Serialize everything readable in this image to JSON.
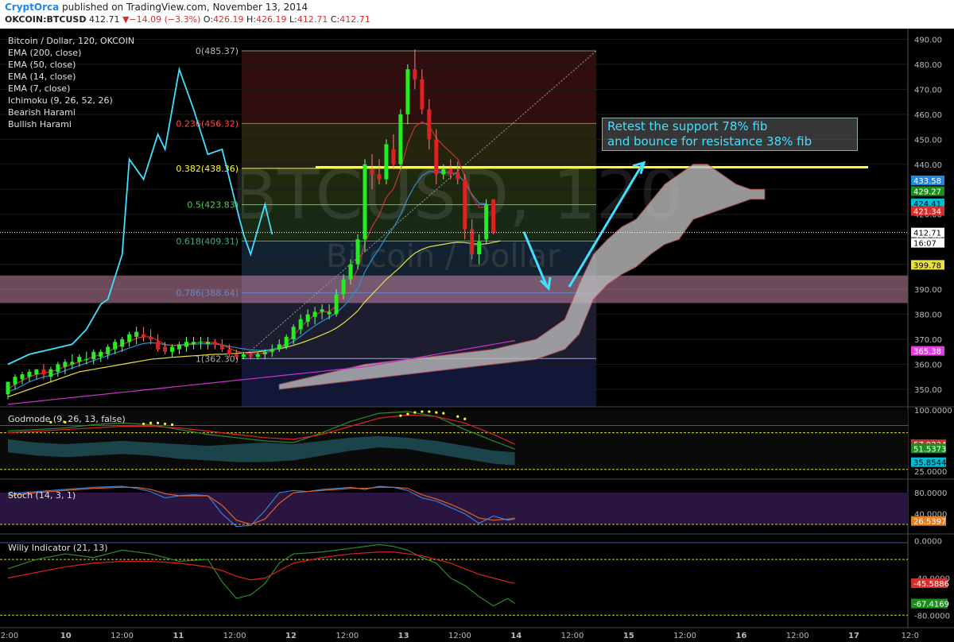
{
  "header": {
    "author": "CryptOrca",
    "published": "published on TradingView.com, November 13, 2014",
    "symbol": "OKCOIN:BTCUSD",
    "last": "412.71",
    "change_arrow": "▼",
    "change": "−14.09 (−3.3%)",
    "o_label": "O:",
    "o": "426.19",
    "h_label": "H:",
    "h": "426.19",
    "l_label": "L:",
    "l": "412.71",
    "c_label": "C:",
    "c": "412.71"
  },
  "colors": {
    "background": "#000000",
    "bull": "#22ee22",
    "bear": "#dd2222",
    "ema200": "#cc33cc",
    "ema50": "#e8e040",
    "ema14": "#2a8fd0",
    "ema7": "#cc3333",
    "cyan_trend": "#40e0ff",
    "cloud": "#bbbbbb",
    "fib_line": "#ffff33",
    "support_band": "#c586a8"
  },
  "main_panel": {
    "title": "Bitcoin / Dollar, 120, OKCOIN",
    "indicators": [
      "EMA (200, close)",
      "EMA (50, close)",
      "EMA (14, close)",
      "EMA (7, close)",
      "Ichimoku (9, 26, 52, 26)",
      "Bearish Harami",
      "Bullish Harami"
    ],
    "watermark_symbol": "BTCUSD, 120",
    "watermark_name": "Bitcoin / Dollar",
    "annotation": [
      "Retest the support 78% fib",
      "and bounce for resistance 38% fib"
    ],
    "fib_levels": [
      {
        "label": "0(485.37)",
        "price": 485.37
      },
      {
        "label": "0.236(456.32)",
        "price": 456.32
      },
      {
        "label": "0.382(438.36)",
        "price": 438.36
      },
      {
        "label": "0.5(423.83)",
        "price": 423.83
      },
      {
        "label": "0.618(409.31)",
        "price": 409.31
      },
      {
        "label": "0.786(388.64)",
        "price": 388.64
      },
      {
        "label": "1(362.30)",
        "price": 362.3
      }
    ],
    "y_ticks": [
      "490.00",
      "480.00",
      "470.00",
      "460.00",
      "450.00",
      "440.00",
      "430.00",
      "420.00",
      "410.00",
      "400.00",
      "390.00",
      "380.00",
      "370.00",
      "360.00",
      "350.00"
    ],
    "price_badges": [
      {
        "text": "433.58",
        "price": 433.58,
        "color": "#1e88e5"
      },
      {
        "text": "429.27",
        "price": 429.27,
        "color": "#1b8f1b"
      },
      {
        "text": "424.41",
        "price": 424.41,
        "color": "#00bcd4"
      },
      {
        "text": "421.34",
        "price": 421.34,
        "color": "#d32f2f"
      },
      {
        "text": "412.71",
        "price": 412.71,
        "color": "#ffffff"
      },
      {
        "text": "16:07",
        "price": 408.6,
        "color": "#ffffff"
      },
      {
        "text": "399.78",
        "price": 399.78,
        "color": "#e8e040"
      },
      {
        "text": "365.38",
        "price": 365.38,
        "color": "#e040e0"
      }
    ]
  },
  "godmode_panel": {
    "title": "Godmode (9, 26, 13, false)",
    "y_ticks": [
      {
        "text": "100.0000",
        "v": 100
      },
      {
        "text": "25.0000",
        "v": 25
      }
    ],
    "badges": [
      {
        "text": "57.9234",
        "v": 57.9,
        "color": "#d32f2f"
      },
      {
        "text": "51.5373",
        "v": 52.8,
        "color": "#1b8f1b"
      },
      {
        "text": "35.8544",
        "v": 35.9,
        "color": "#00bcd4"
      }
    ]
  },
  "stoch_panel": {
    "title": "Stoch (14, 3, 1)",
    "y_ticks": [
      {
        "text": "80.0000",
        "v": 80
      },
      {
        "text": "40.0000",
        "v": 40
      }
    ],
    "badges": [
      {
        "text": "26.5397",
        "v": 26.5,
        "color": "#e67e22"
      }
    ]
  },
  "willy_panel": {
    "title": "Willy Indicator (21, 13)",
    "y_ticks": [
      {
        "text": "0.0000",
        "v": 0
      },
      {
        "text": "-40.0000",
        "v": -40
      },
      {
        "text": "-80.0000",
        "v": -80
      }
    ],
    "badges": [
      {
        "text": "-45.5886",
        "v": -45.6,
        "color": "#d32f2f"
      },
      {
        "text": "-67.4169",
        "v": -67.4,
        "color": "#1b8f1b"
      }
    ]
  },
  "x_axis": {
    "ticks": [
      "2:00",
      "10",
      "12:00",
      "11",
      "12:00",
      "12",
      "12:00",
      "13",
      "12:00",
      "14",
      "12:00",
      "15",
      "12:00",
      "16",
      "12:00",
      "17",
      "12:0"
    ]
  },
  "chart_data": {
    "type": "candlestick",
    "title": "Bitcoin / Dollar, 120, OKCOIN",
    "ylim": [
      343,
      493
    ],
    "candles": [
      {
        "o": 348,
        "h": 353,
        "l": 346,
        "c": 353
      },
      {
        "o": 352,
        "h": 356,
        "l": 350,
        "c": 355
      },
      {
        "o": 354,
        "h": 357,
        "l": 352,
        "c": 356
      },
      {
        "o": 355,
        "h": 358,
        "l": 353,
        "c": 357
      },
      {
        "o": 356,
        "h": 358,
        "l": 354,
        "c": 358
      },
      {
        "o": 358,
        "h": 360,
        "l": 354,
        "c": 356
      },
      {
        "o": 355,
        "h": 359,
        "l": 353,
        "c": 358
      },
      {
        "o": 357,
        "h": 361,
        "l": 355,
        "c": 360
      },
      {
        "o": 359,
        "h": 362,
        "l": 356,
        "c": 361
      },
      {
        "o": 360,
        "h": 364,
        "l": 358,
        "c": 361
      },
      {
        "o": 361,
        "h": 364,
        "l": 359,
        "c": 363
      },
      {
        "o": 362,
        "h": 365,
        "l": 360,
        "c": 362
      },
      {
        "o": 362,
        "h": 366,
        "l": 360,
        "c": 365
      },
      {
        "o": 363,
        "h": 366,
        "l": 361,
        "c": 365
      },
      {
        "o": 364,
        "h": 368,
        "l": 362,
        "c": 367
      },
      {
        "o": 366,
        "h": 370,
        "l": 364,
        "c": 369
      },
      {
        "o": 367,
        "h": 371,
        "l": 365,
        "c": 370
      },
      {
        "o": 369,
        "h": 373,
        "l": 367,
        "c": 372
      },
      {
        "o": 371,
        "h": 375,
        "l": 368,
        "c": 373
      },
      {
        "o": 372,
        "h": 375,
        "l": 369,
        "c": 371
      },
      {
        "o": 371,
        "h": 374,
        "l": 368,
        "c": 370
      },
      {
        "o": 369,
        "h": 372,
        "l": 365,
        "c": 366
      },
      {
        "o": 367,
        "h": 369,
        "l": 364,
        "c": 365
      },
      {
        "o": 365,
        "h": 368,
        "l": 363,
        "c": 367
      },
      {
        "o": 366,
        "h": 369,
        "l": 364,
        "c": 368
      },
      {
        "o": 367,
        "h": 371,
        "l": 365,
        "c": 369
      },
      {
        "o": 368,
        "h": 371,
        "l": 366,
        "c": 369
      },
      {
        "o": 369,
        "h": 371,
        "l": 366,
        "c": 369
      },
      {
        "o": 368,
        "h": 371,
        "l": 366,
        "c": 369
      },
      {
        "o": 369,
        "h": 370,
        "l": 366,
        "c": 368
      },
      {
        "o": 368,
        "h": 370,
        "l": 365,
        "c": 366
      },
      {
        "o": 366,
        "h": 368,
        "l": 363,
        "c": 364
      },
      {
        "o": 364,
        "h": 366,
        "l": 362,
        "c": 363
      },
      {
        "o": 363,
        "h": 365,
        "l": 362,
        "c": 364
      },
      {
        "o": 364,
        "h": 365,
        "l": 362,
        "c": 363
      },
      {
        "o": 363,
        "h": 365,
        "l": 362,
        "c": 364
      },
      {
        "o": 364,
        "h": 366,
        "l": 362,
        "c": 365
      },
      {
        "o": 365,
        "h": 368,
        "l": 363,
        "c": 366
      },
      {
        "o": 366,
        "h": 370,
        "l": 365,
        "c": 368
      },
      {
        "o": 367,
        "h": 372,
        "l": 366,
        "c": 371
      },
      {
        "o": 370,
        "h": 376,
        "l": 368,
        "c": 375
      },
      {
        "o": 374,
        "h": 380,
        "l": 372,
        "c": 378
      },
      {
        "o": 377,
        "h": 382,
        "l": 375,
        "c": 380
      },
      {
        "o": 379,
        "h": 383,
        "l": 376,
        "c": 381
      },
      {
        "o": 381,
        "h": 384,
        "l": 378,
        "c": 382
      },
      {
        "o": 380,
        "h": 384,
        "l": 378,
        "c": 381
      },
      {
        "o": 380,
        "h": 390,
        "l": 379,
        "c": 388
      },
      {
        "o": 388,
        "h": 396,
        "l": 386,
        "c": 394
      },
      {
        "o": 394,
        "h": 402,
        "l": 392,
        "c": 400
      },
      {
        "o": 400,
        "h": 412,
        "l": 398,
        "c": 410
      },
      {
        "o": 410,
        "h": 442,
        "l": 405,
        "c": 440
      },
      {
        "o": 438,
        "h": 444,
        "l": 430,
        "c": 436
      },
      {
        "o": 436,
        "h": 442,
        "l": 432,
        "c": 434
      },
      {
        "o": 434,
        "h": 450,
        "l": 432,
        "c": 448
      },
      {
        "o": 446,
        "h": 452,
        "l": 438,
        "c": 440
      },
      {
        "o": 440,
        "h": 462,
        "l": 438,
        "c": 460
      },
      {
        "o": 460,
        "h": 480,
        "l": 456,
        "c": 478
      },
      {
        "o": 478,
        "h": 486,
        "l": 470,
        "c": 474
      },
      {
        "o": 474,
        "h": 478,
        "l": 460,
        "c": 462
      },
      {
        "o": 462,
        "h": 466,
        "l": 446,
        "c": 450
      },
      {
        "o": 450,
        "h": 454,
        "l": 432,
        "c": 436
      },
      {
        "o": 436,
        "h": 440,
        "l": 434,
        "c": 438
      },
      {
        "o": 438,
        "h": 442,
        "l": 434,
        "c": 436
      },
      {
        "o": 437,
        "h": 441,
        "l": 432,
        "c": 434
      },
      {
        "o": 434,
        "h": 436,
        "l": 410,
        "c": 414
      },
      {
        "o": 414,
        "h": 418,
        "l": 402,
        "c": 404
      },
      {
        "o": 404,
        "h": 412,
        "l": 400,
        "c": 409
      },
      {
        "o": 410,
        "h": 426,
        "l": 408,
        "c": 424
      },
      {
        "o": 426,
        "h": 426,
        "l": 412,
        "c": 412.71
      }
    ]
  }
}
